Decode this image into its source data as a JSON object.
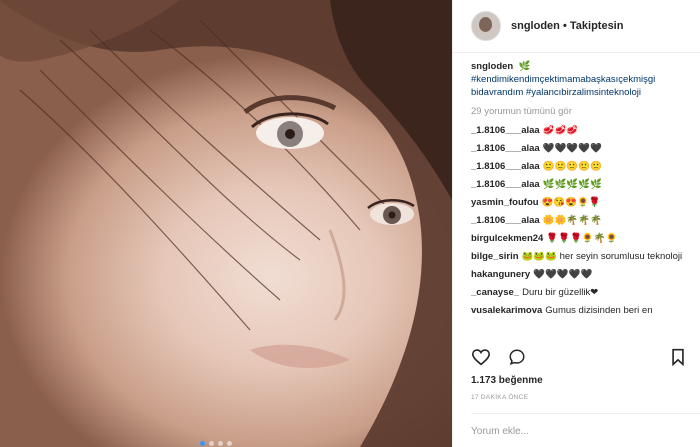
{
  "post": {
    "username": "sngloden",
    "separator": "•",
    "follow_label": "Takiptesin",
    "caption_user": "sngloden",
    "caption_emoji": "🌿",
    "caption_tags": "#kendimikendimçektimamabaşkasıçekmişgi bidavrandım #yalancıbirzalimsinteknoloji",
    "view_all": "29 yorumun tümünü gör",
    "comments": [
      {
        "user": "_1.8106___alaa",
        "text": "🥩🥩🥩"
      },
      {
        "user": "_1.8106___alaa",
        "text": "🖤🖤🖤🖤🖤"
      },
      {
        "user": "_1.8106___alaa",
        "text": "🙂🙂🙂🙂🙂"
      },
      {
        "user": "_1.8106___alaa",
        "text": "🌿🌿🌿🌿🌿"
      },
      {
        "user": "yasmin_foufou",
        "text": "😍😘😍🌻🌹"
      },
      {
        "user": "_1.8106___alaa",
        "text": "🌼🌼🌴🌴🌴"
      },
      {
        "user": "birgulcekmen24",
        "text": "🌹🌹🌹🌻🌴🌻"
      },
      {
        "user": "bilge_sirin",
        "text": "🐸🐸🐸 her seyin sorumlusu teknoloji"
      },
      {
        "user": "hakangunery",
        "text": "🖤🖤🖤🖤🖤"
      },
      {
        "user": "_canayse_",
        "text": "Duru bir güzellik❤"
      },
      {
        "user": "vusalekarimova",
        "text": "Gumus dizisinden beri en"
      }
    ],
    "likes": "1.173 beğenme",
    "time": "17 DAKİKA ÖNCE",
    "comment_placeholder": "Yorum ekle..."
  }
}
